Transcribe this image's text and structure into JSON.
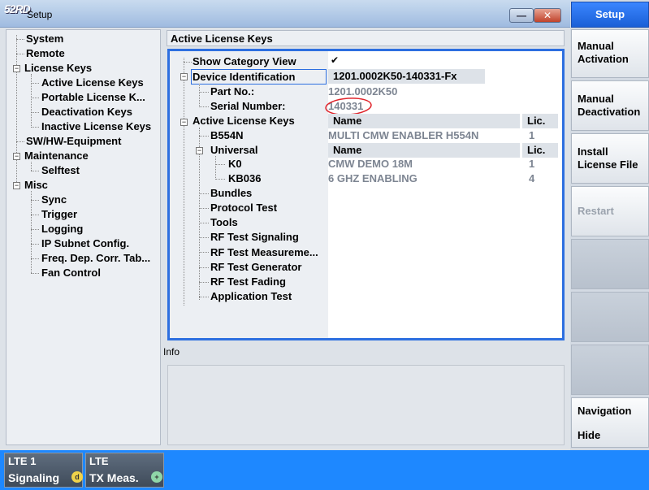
{
  "window": {
    "logo": "52RD",
    "title": "Setup",
    "minimize_glyph": "—",
    "close_glyph": "✕"
  },
  "left_tree": {
    "items": [
      {
        "label": "System"
      },
      {
        "label": "Remote"
      },
      {
        "label": "License Keys"
      },
      {
        "label": "Active License Keys"
      },
      {
        "label": "Portable License K..."
      },
      {
        "label": "Deactivation Keys"
      },
      {
        "label": "Inactive License Keys"
      },
      {
        "label": "SW/HW-Equipment"
      },
      {
        "label": "Maintenance"
      },
      {
        "label": "Selftest"
      },
      {
        "label": "Misc"
      },
      {
        "label": "Sync"
      },
      {
        "label": "Trigger"
      },
      {
        "label": "Logging"
      },
      {
        "label": "IP Subnet Config."
      },
      {
        "label": "Freq. Dep. Corr. Tab..."
      },
      {
        "label": "Fan Control"
      }
    ],
    "expander_minus": "−"
  },
  "content": {
    "header": "Active License Keys",
    "tree": [
      {
        "label": "Show Category View"
      },
      {
        "label": "Device Identification"
      },
      {
        "label": "Part No.:"
      },
      {
        "label": "Serial Number:"
      },
      {
        "label": "Active License Keys"
      },
      {
        "label": "B554N"
      },
      {
        "label": "Universal"
      },
      {
        "label": "K0"
      },
      {
        "label": "KB036"
      },
      {
        "label": "Bundles"
      },
      {
        "label": "Protocol Test"
      },
      {
        "label": "Tools"
      },
      {
        "label": "RF Test Signaling"
      },
      {
        "label": "RF Test Measureme..."
      },
      {
        "label": "RF Test Generator"
      },
      {
        "label": "RF Test Fading"
      },
      {
        "label": "Application Test"
      }
    ],
    "show_category_checked": "✔",
    "device_id_value": "1201.0002K50-140331-Fx",
    "part_no_value": "1201.0002K50",
    "serial_value": "140331",
    "table1": {
      "col_name": "Name",
      "col_lic": "Lic.",
      "row_name": "MULTI CMW ENABLER H554N",
      "row_lic": "1"
    },
    "table2": {
      "col_name": "Name",
      "col_lic": "Lic.",
      "rows": [
        {
          "name": "CMW DEMO 18M",
          "lic": "1"
        },
        {
          "name": "6 GHZ ENABLING",
          "lic": "4"
        }
      ]
    }
  },
  "info": {
    "label": "Info"
  },
  "sidebar": {
    "setup": "Setup",
    "manual_activation": [
      "Manual",
      "Activation"
    ],
    "manual_deactivation": [
      "Manual",
      "Deactivation"
    ],
    "install_license": [
      "Install",
      "License File"
    ],
    "restart": "Restart",
    "navigation": "Navigation",
    "hide": "Hide"
  },
  "taskbar": [
    {
      "line1": "LTE 1",
      "line2": "Signaling",
      "badge": "d"
    },
    {
      "line1": "LTE",
      "line2": "TX Meas.",
      "badge": "+"
    }
  ],
  "colors": {
    "accent": "#2d6fe0",
    "bottom_bar": "#1e88ff",
    "annotation": "#e0242b"
  }
}
